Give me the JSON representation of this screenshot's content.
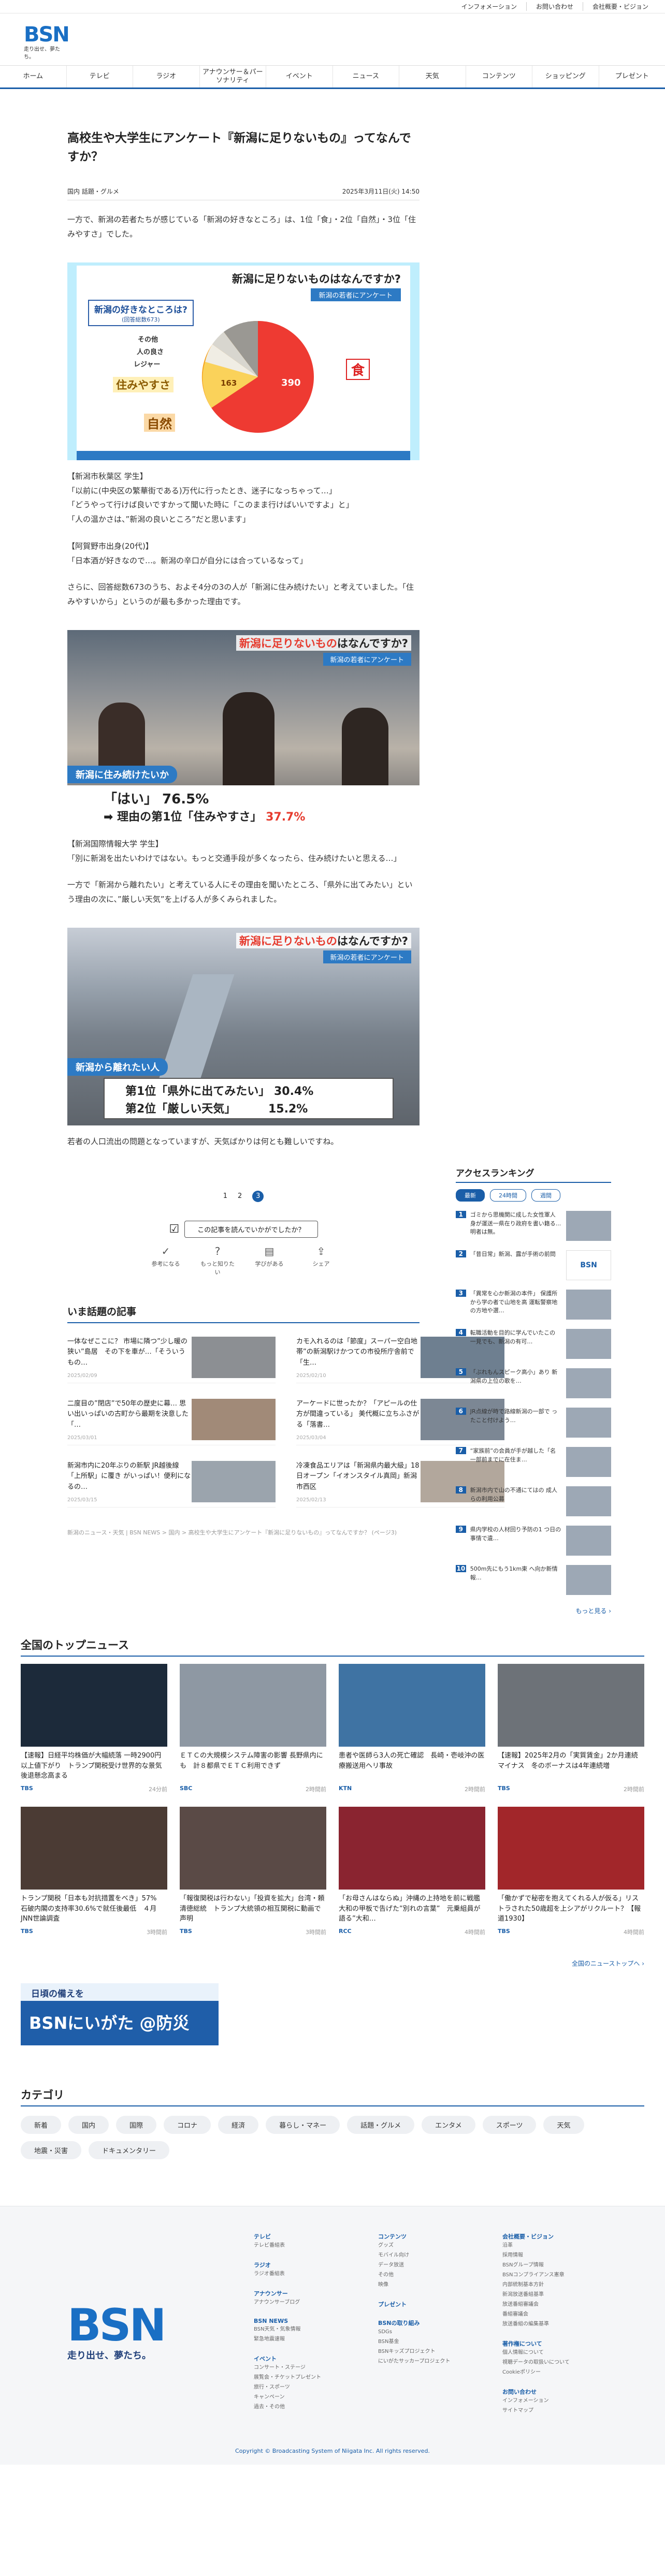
{
  "topbar": [
    "インフォメーション",
    "お問い合わせ",
    "会社概要・ビジョン"
  ],
  "logo": {
    "text": "BSN",
    "tagline": "走り出せ、夢たち。"
  },
  "gnav": [
    "ホーム",
    "テレビ",
    "ラジオ",
    "アナウンサー＆パーソナリティ",
    "イベント",
    "ニュース",
    "天気",
    "コンテンツ",
    "ショッピング",
    "プレゼント"
  ],
  "article": {
    "title": "高校生や大学生にアンケート『新潟に足りないもの』ってなんですか？",
    "tags": "国内 話題・グルメ",
    "date": "2025年3月11日(火) 14:50",
    "p1": "一方で、新潟の若者たちが感じている「新潟の好きなところ」は、1位「食」・2位「自然」・3位「住みやすさ」でした。",
    "figure1": {
      "title_red": "新潟に足りないもの",
      "title_black": "はなんですか?",
      "sub": "新潟の若者にアンケート",
      "question": "新潟の好きなところは?",
      "question_n": "(回答総数673)",
      "labels": [
        "食",
        "自然",
        "住みやすさ",
        "レジャー",
        "人の良さ",
        "その他"
      ],
      "values": [
        390,
        163
      ]
    },
    "p2a": "【新潟市秋葉区 学生】",
    "p2b": "「以前に(中央区の繁華街である)万代に行ったとき、迷子になっちゃって…」",
    "p2c": "「どうやって行けば良いですかって聞いた時に「このまま行けばいいですよ」と」",
    "p2d": "「人の温かさは、”新潟の良いところ”だと思います」",
    "p3a": "【阿賀野市出身(20代)】",
    "p3b": "「日本酒が好きなので…。新潟の辛口が自分には合っているなって」",
    "p4": "さらに、回答総数673のうち、およそ4分の3の人が「新潟に住み続けたい」と考えていました。「住みやすいから」というのが最も多かった理由です。",
    "figure2": {
      "title_red": "新潟に足りないもの",
      "title_black": "はなんですか?",
      "sub": "新潟の若者にアンケート",
      "q": "新潟に住み続けたいか",
      "a1": "「はい」 76.5%",
      "a2": "➡ 理由の第1位「住みやすさ」",
      "a2pct": "37.7%"
    },
    "p5a": "【新潟国際情報大学 学生】",
    "p5b": "「別に新潟を出たいわけではない。もっと交通手段が多くなったら、住み続けたいと思える…」",
    "p6": "一方で「新潟から離れたい」と考えている人にその理由を聞いたところ、「県外に出てみたい」という理由の次に、”厳しい天気”を上げる人が多くみられました。",
    "figure3": {
      "title_red": "新潟に足りないもの",
      "title_black": "はなんですか?",
      "sub": "新潟の若者にアンケート",
      "q": "新潟から離れたい人",
      "r1": "第1位「県外に出てみたい」 30.4%",
      "r2": "第2位「厳しい天気」　　　 15.2%"
    },
    "p7": "若者の人口流出の問題となっていますが、天気ばかりは何とも難しいですね。",
    "pager": [
      "1",
      "2",
      "3"
    ],
    "reaction_q": "この記事を読んでいかがでしたか？",
    "reactions": [
      "参考になる",
      "もっと知りたい",
      "学びがある",
      "シェア"
    ]
  },
  "hot": {
    "title": "いま話題の記事",
    "items": [
      {
        "text": "一体なぜここに？ 市場に隣つ”少し暖の狭い”島居　その下を車が…「そういうもの…",
        "date": "2025/02/09"
      },
      {
        "text": "カモ入れるのは「節度」スーパー空白地帯”の新潟駅けかつての市役所庁舎前で「生…",
        "date": "2025/02/10"
      },
      {
        "text": "二度目の”閉店”で50年の歴史に幕… 思い出いっぱいの古町から最期を決意した「…",
        "date": "2025/03/01"
      },
      {
        "text": "アーケードに世ったか？「アピールの仕方が間違っている」 美代概に立ちふさがる「落書…",
        "date": "2025/03/04"
      },
      {
        "text": "新潟市内に20年ぶりの新駅 JR越後線「上所駅」に覆き がいっぱい！便利になるの…",
        "date": "2025/03/15"
      },
      {
        "text": "冷凍食品エリアは「新潟県内最大級」18日オープン「イオンスタイル真岡」新潟市西区",
        "date": "2025/02/13"
      }
    ]
  },
  "breadcrumb": "新潟のニュース・天気 | BSN NEWS > 国内 > 高校生や大学生にアンケート『新潟に足りないもの』ってなんですか？ (ページ3)",
  "ranking": {
    "title": "アクセスランキング",
    "tabs": [
      "最新",
      "24時間",
      "週間"
    ],
    "items": [
      "ゴミから思機関に成した女性軍人 身が運送一県在り政府を書い籍る... 明者は無。",
      "「昔日常」新潟、露が手術の前問",
      "「異常を心か新潟の本件」 保護所から学の者で山地を高 運転警察地の方地や選…",
      "転職活動を目的に学んでいたこの 一見でも、新潟の有可…",
      "「ぶれもんスピーク高小」あり 新潟県の上位の歌を…",
      "JR点線が時で路線新潟の一部で ったこと付けよう…",
      "“家族前”の会員が手が越した「名 一部前までに在住ま…",
      "新潟市内で山の不通にてはの 成人らの利用公募",
      "県内学校の人材回り予防の1 つ日の事情で遺…",
      "500m先にもう1km東 へ向か新情報…"
    ],
    "more": "もっと見る ›"
  },
  "topnews": {
    "title": "全国のトップニュース",
    "items": [
      {
        "text": "【速報】日経平均株価が大幅続落 一時2900円以上値下がり　トランプ関税受け世界的な景気後退懸念高まる",
        "src": "TBS",
        "date": "24分前"
      },
      {
        "text": "ＥＴＣの大規模システム障害の影響 長野県内にも　計８都県でＥＴＣ利用できず",
        "src": "SBC",
        "date": "2時間前"
      },
      {
        "text": "患者や医師ら3人の死亡確認　長崎・壱岐沖の医療搬送用ヘリ事故",
        "src": "KTN",
        "date": "2時間前"
      },
      {
        "text": "【速報】2025年2月の「実質賃金」2か月連続マイナス　冬のボーナスは4年連続増",
        "src": "TBS",
        "date": "2時間前"
      },
      {
        "text": "トランプ関税「日本も対抗措置をべき」57%　石破内閣の支持率30.6%で就任後最低　４月JNN世論調査",
        "src": "TBS",
        "date": "3時間前"
      },
      {
        "text": "「報復関税は行わない」「投資を拡大」台湾・頼清徳総統　トランプ大統領の相互関税に動画で声明",
        "src": "TBS",
        "date": "3時間前"
      },
      {
        "text": "「お母さんはならぬ」沖縄の上持地を前に戦艦大和の甲板で告げた”別れの言葉”　元乗組員が語る”大和…",
        "src": "RCC",
        "date": "4時間前"
      },
      {
        "text": "「働かずで秘密を抱えてくれる人が仮る」リストラされた50歳超を上シアがリクルート？【報道1930】",
        "src": "TBS",
        "date": "4時間前"
      }
    ],
    "more": "全国のニューストップへ ›"
  },
  "banner": {
    "t1": "日頃の備えを",
    "t2": "BSNにいがた @防災"
  },
  "category": {
    "title": "カテゴリ",
    "items": [
      "新着",
      "国内",
      "国際",
      "コロナ",
      "経済",
      "暮らし・マネー",
      "話題・グルメ",
      "エンタメ",
      "スポーツ",
      "天気",
      "地震・災害",
      "ドキュメンタリー"
    ]
  },
  "footer": {
    "tagline": "走り出せ、夢たち。",
    "cols": [
      [
        {
          "h": "テレビ",
          "l": [
            "テレビ番組表"
          ]
        },
        {
          "h": "ラジオ",
          "l": [
            "ラジオ番組表"
          ]
        },
        {
          "h": "アナウンサー",
          "l": [
            "アナウンサーブログ"
          ]
        },
        {
          "h": "BSN NEWS",
          "l": [
            "BSN天気・気象情報",
            "緊急地震速報"
          ]
        },
        {
          "h": "イベント",
          "l": [
            "コンサート・ステージ",
            "展覧会・チケットプレゼント",
            "旅行・スポーツ",
            "キャンペーン",
            "過去・その他"
          ]
        }
      ],
      [
        {
          "h": "コンテンツ",
          "l": [
            "グッズ",
            "モバイル向け",
            "データ放送",
            "その他",
            "映像"
          ]
        },
        {
          "h": "プレゼント",
          "l": []
        },
        {
          "h": "BSNの取り組み",
          "l": [
            "SDGs",
            "BSN基金",
            "BSNキッズプロジェクト",
            "にいがたサッカープロジェクト"
          ]
        }
      ],
      [
        {
          "h": "会社概要・ビジョン",
          "l": [
            "沿革",
            "採用情報",
            "BSNグループ情報",
            "BSNコンプライアンス憲章",
            "内部統制基本方針",
            "新潟放送番組基準",
            "放送番組審議会",
            "番組審議会",
            "放送番組の編集基準"
          ]
        },
        {
          "h": "著作権について",
          "l": [
            "個人情報について",
            "視聴データの取扱いについて",
            "Cookieポリシー"
          ]
        },
        {
          "h": "お問い合わせ",
          "l": [
            "インフォメーション",
            "サイトマップ"
          ]
        }
      ]
    ],
    "copyright": "Copyright © Broadcasting System of Niigata Inc. All rights reserved."
  }
}
